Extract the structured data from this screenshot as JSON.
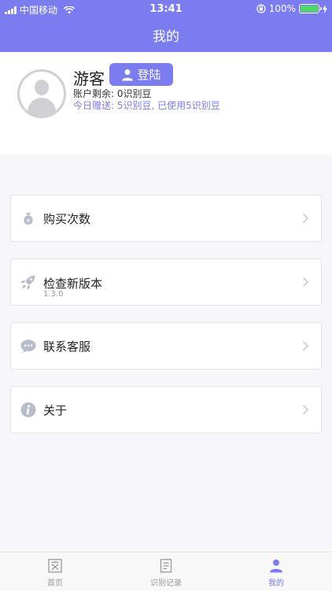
{
  "status_bar": {
    "carrier": "中国移动",
    "time": "13:41",
    "battery": "100%"
  },
  "nav": {
    "title": "我的"
  },
  "profile": {
    "name": "游客",
    "login_label": "登陆",
    "balance": "账户剩余: 0识别豆",
    "gift": "今日赠送: 5识别豆, 已使用5识别豆"
  },
  "menu": [
    {
      "label": "购买次数",
      "sub": "",
      "icon": "money-bag-icon"
    },
    {
      "label": "检查新版本",
      "sub": "1.3.0",
      "icon": "rocket-icon"
    },
    {
      "label": "联系客服",
      "sub": "",
      "icon": "chat-bubble-icon"
    },
    {
      "label": "关于",
      "sub": "",
      "icon": "info-icon"
    }
  ],
  "tabs": [
    {
      "label": "首页",
      "icon": "home-text-icon"
    },
    {
      "label": "识别记录",
      "icon": "document-icon"
    },
    {
      "label": "我的",
      "icon": "person-icon",
      "active": true
    }
  ],
  "colors": {
    "accent": "#7a7cf0",
    "icon_gray": "#b8bccb",
    "battery_green": "#4cd964"
  }
}
